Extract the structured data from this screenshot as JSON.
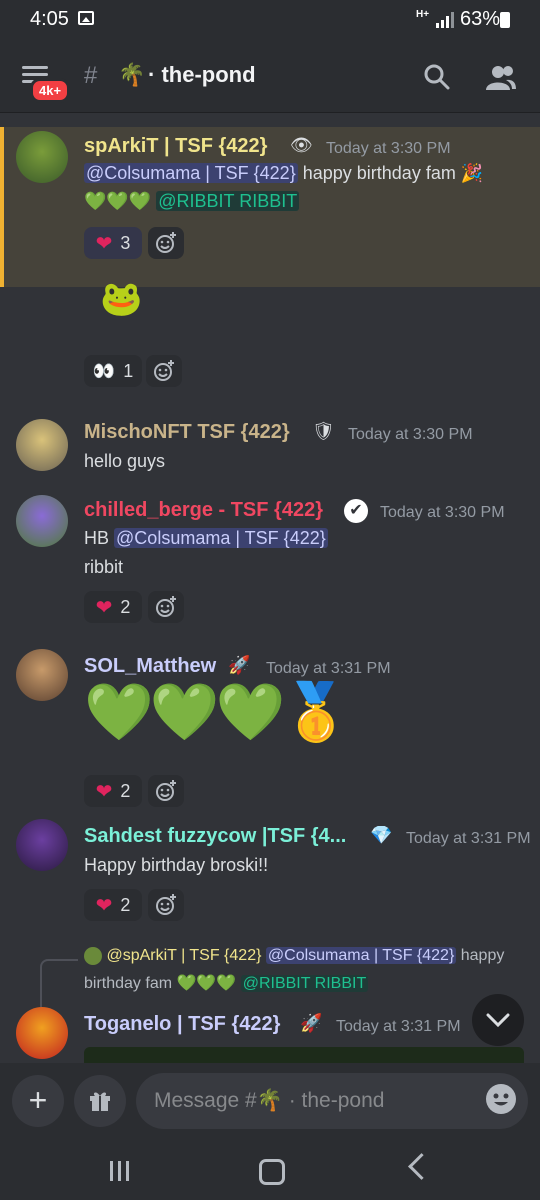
{
  "status_bar": {
    "time": "4:05",
    "network": "H+",
    "battery": "63%"
  },
  "header": {
    "badge": "4k+",
    "hash": "#",
    "channel_emoji": "🌴",
    "channel_name": "· the-pond"
  },
  "messages": [
    {
      "username": "spArkiT | TSF {422}",
      "username_color": "#f0e48c",
      "badge": "👁",
      "timestamp": "Today at 3:30 PM",
      "mention": "@Colsumama | TSF {422}",
      "text": "happy birthday fam",
      "text_emoji": "🎉",
      "hearts": "💚💚💚",
      "role_mention": "@RIBBIT RIBBIT",
      "reactions": [
        {
          "emoji": "❤",
          "count": "3"
        }
      ]
    },
    {
      "sticker": "🐸",
      "reactions": [
        {
          "emoji": "👀",
          "count": "1"
        }
      ]
    },
    {
      "username": "MischoNFT TSF {422}",
      "username_color": "#c9b48a",
      "badge": "🛡",
      "timestamp": "Today at 3:30 PM",
      "text": "hello guys"
    },
    {
      "username": "chilled_berge - TSF {422}",
      "username_color": "#f04761",
      "badge": "✔",
      "timestamp": "Today at 3:30 PM",
      "prefix": "HB",
      "mention": "@Colsumama | TSF {422}",
      "text2": "ribbit",
      "reactions": [
        {
          "emoji": "❤",
          "count": "2"
        }
      ]
    },
    {
      "username": "SOL_Matthew",
      "username_color": "#c9cdfb",
      "badge": "🚀",
      "timestamp": "Today at 3:31 PM",
      "big_hearts": "💚💚💚",
      "medal": "🥇",
      "reactions": [
        {
          "emoji": "❤",
          "count": "2"
        }
      ]
    },
    {
      "username": "Sahdest fuzzycow |TSF {4...",
      "username_color": "#7bf0d8",
      "badge": "💎",
      "timestamp": "Today at 3:31 PM",
      "text": "Happy birthday broski!!",
      "reactions": [
        {
          "emoji": "❤",
          "count": "2"
        }
      ]
    },
    {
      "reply_user": "@spArkiT | TSF {422}",
      "reply_mention": "@Colsumama | TSF {422}",
      "reply_text": "happy",
      "reply_text2": "birthday fam",
      "reply_hearts": "💚💚💚",
      "reply_role": "@RIBBIT RIBBIT",
      "username": "Toganelo | TSF {422}",
      "username_color": "#c9cdfb",
      "badge": "🚀",
      "timestamp": "Today at 3:31 PM"
    }
  ],
  "input": {
    "placeholder": "Message #🌴 · the-pond"
  },
  "colors": {
    "accent_highlight": "#f0b232",
    "heart": "#e0245e",
    "green_heart": "#78b159"
  }
}
